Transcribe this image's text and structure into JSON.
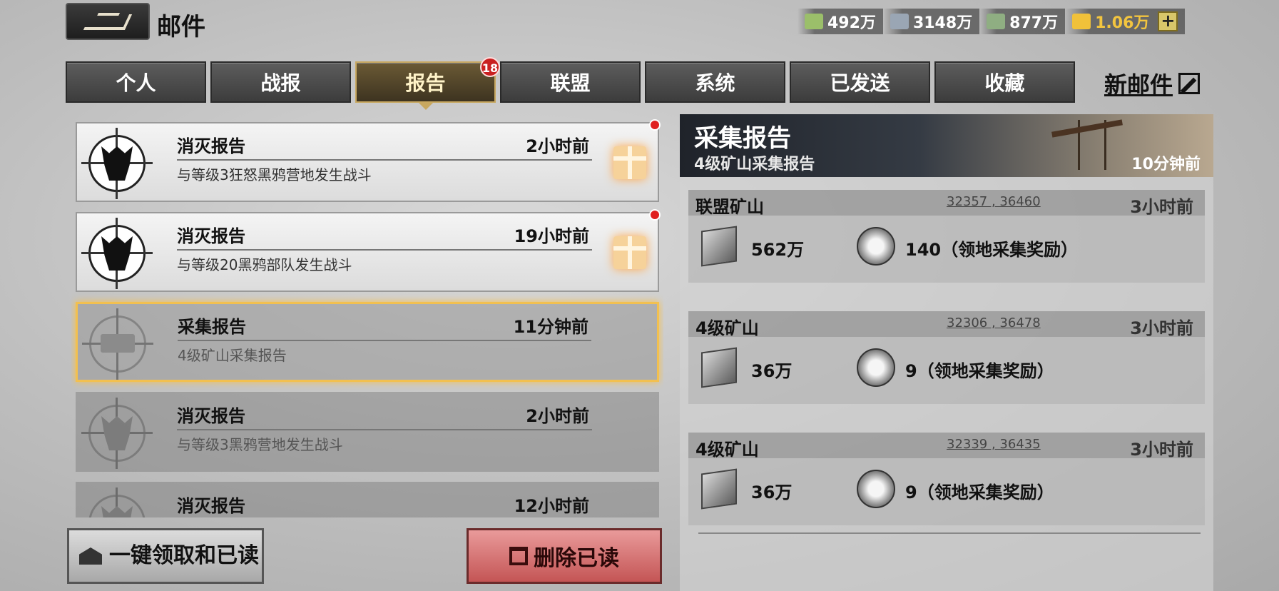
{
  "header": {
    "title": "邮件"
  },
  "resources": [
    {
      "icon": "cash-icon",
      "value": "492万",
      "color": "#9bbf6a"
    },
    {
      "icon": "steel-icon",
      "value": "3148万",
      "color": "#9aa6b4"
    },
    {
      "icon": "oil-icon",
      "value": "877万",
      "color": "#8fae82"
    },
    {
      "icon": "gold-icon",
      "value": "1.06万",
      "color": "#f0c13a"
    }
  ],
  "tabs": [
    {
      "label": "个人"
    },
    {
      "label": "战报"
    },
    {
      "label": "报告",
      "badge": "18"
    },
    {
      "label": "联盟"
    },
    {
      "label": "系统"
    },
    {
      "label": "已发送"
    },
    {
      "label": "收藏"
    }
  ],
  "new_mail": {
    "label": "新邮件"
  },
  "mails": [
    {
      "title": "消灭报告",
      "time": "2小时前",
      "subtitle": "与等级3狂怒黑鸦营地发生战斗"
    },
    {
      "title": "消灭报告",
      "time": "19小时前",
      "subtitle": "与等级20黑鸦部队发生战斗"
    },
    {
      "title": "采集报告",
      "time": "11分钟前",
      "subtitle": "4级矿山采集报告"
    },
    {
      "title": "消灭报告",
      "time": "2小时前",
      "subtitle": "与等级3黑鸦营地发生战斗"
    },
    {
      "title": "消灭报告",
      "time": "12小时前",
      "subtitle": ""
    }
  ],
  "buttons": {
    "claim": "一键领取和已读",
    "delete": "删除已读"
  },
  "detail": {
    "title": "采集报告",
    "subtitle": "4级矿山采集报告",
    "time": "10分钟前",
    "mines": [
      {
        "name": "联盟矿山",
        "coords": "32357 , 36460",
        "time": "3小时前",
        "ore": "562万",
        "bonus": "140（领地采集奖励）"
      },
      {
        "name": "4级矿山",
        "coords": "32306 , 36478",
        "time": "3小时前",
        "ore": "36万",
        "bonus": "9（领地采集奖励）"
      },
      {
        "name": "4级矿山",
        "coords": "32339 , 36435",
        "time": "3小时前",
        "ore": "36万",
        "bonus": "9（领地采集奖励）"
      }
    ]
  }
}
